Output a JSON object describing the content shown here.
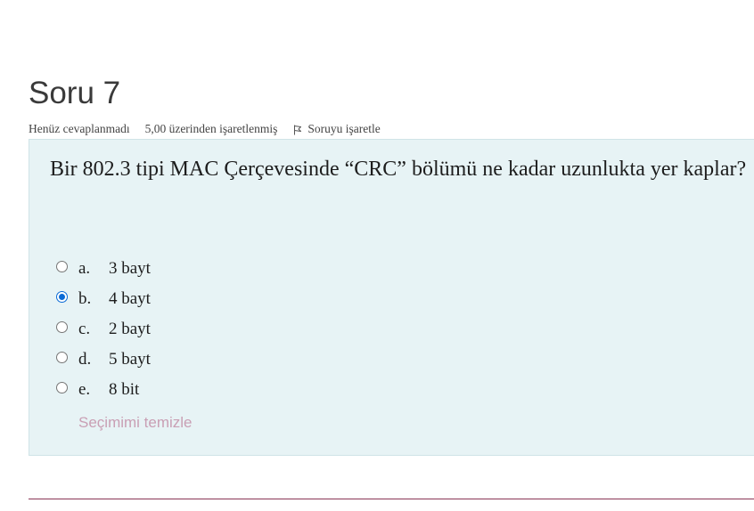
{
  "question": {
    "title": "Soru 7",
    "state": "Henüz cevaplanmadı",
    "grade": "5,00 üzerinden işaretlenmiş",
    "flag_label": "Soruyu işaretle",
    "text": "Bir 802.3 tipi MAC Çerçevesinde “CRC” bölümü ne kadar uzunlukta yer kaplar?",
    "answers": [
      {
        "letter": "a.",
        "label": "3 bayt",
        "selected": false
      },
      {
        "letter": "b.",
        "label": "4 bayt",
        "selected": true
      },
      {
        "letter": "c.",
        "label": "2 bayt",
        "selected": false
      },
      {
        "letter": "d.",
        "label": "5 bayt",
        "selected": false
      },
      {
        "letter": "e.",
        "label": "8 bit",
        "selected": false
      }
    ],
    "clear_label": "Seçimimi temizle"
  },
  "icons": {
    "flag": "flag-icon"
  },
  "colors": {
    "question_box_bg": "#e7f3f5",
    "selected_radio": "#0b6bd6",
    "clear_link": "#c99fb4",
    "divider": "#8a3656"
  }
}
